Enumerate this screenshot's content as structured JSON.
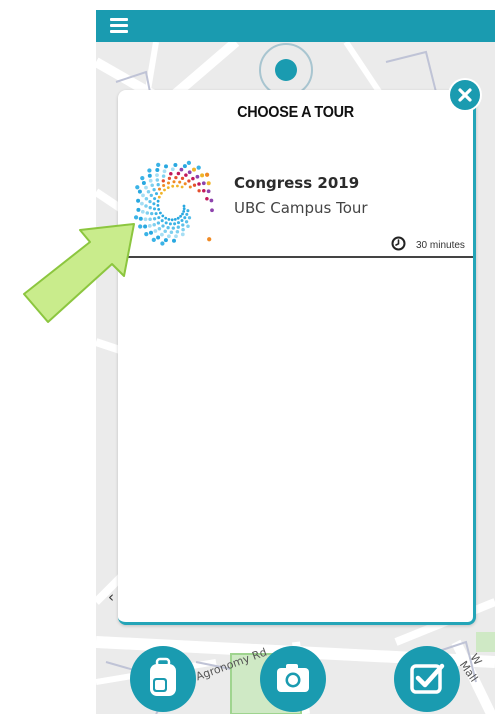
{
  "modal": {
    "title": "CHOOSE A TOUR",
    "tours": [
      {
        "name": "Congress 2019",
        "subtitle": "UBC Campus Tour",
        "duration": "30 minutes",
        "logo_icon": "congress-spiral-logo"
      }
    ],
    "close_icon": "close-icon"
  },
  "topbar": {
    "menu_icon": "hamburger-menu-icon"
  },
  "map": {
    "street_labels": [
      "Agronomy Rd",
      "W Mall"
    ]
  },
  "bottom_actions": [
    {
      "name": "backpack-icon"
    },
    {
      "name": "camera-icon"
    },
    {
      "name": "checkbox-icon"
    }
  ],
  "annotation": {
    "name": "green-arrow-pointer"
  },
  "colors": {
    "accent": "#1a9bb0",
    "modal_border": "#24a5b8",
    "arrow_fill": "#c9ec8c",
    "arrow_stroke": "#8cc63f"
  }
}
